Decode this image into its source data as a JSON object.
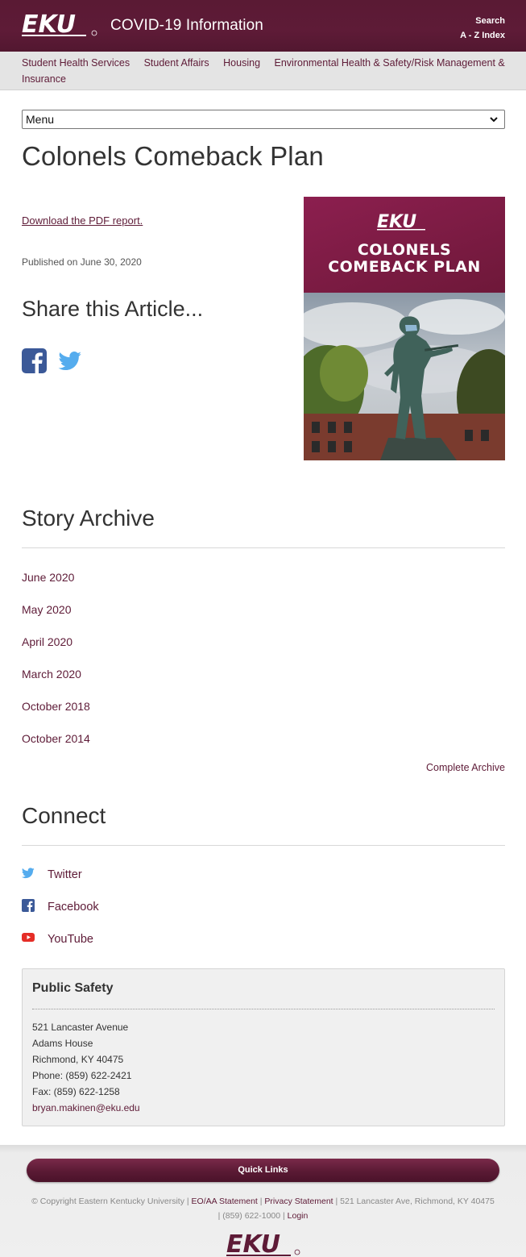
{
  "header": {
    "logo_text": "EKU",
    "site_title": "COVID-19 Information",
    "search_label": "Search",
    "az_label": "A - Z Index"
  },
  "subnav": {
    "items": [
      {
        "label": "Student Health Services"
      },
      {
        "label": "Student Affairs"
      },
      {
        "label": "Housing"
      },
      {
        "label": "Environmental Health & Safety/Risk Management & Insurance"
      }
    ]
  },
  "menu": {
    "selected": "Menu"
  },
  "article": {
    "title": "Colonels Comeback Plan",
    "pdf_link": "Download the PDF report.",
    "published": "Published on June 30, 2020",
    "share_title": "Share this Article..."
  },
  "cover": {
    "logo_text": "EKU",
    "title_line1": "COLONELS",
    "title_line2": "COMEBACK PLAN"
  },
  "archive": {
    "title": "Story Archive",
    "items": [
      {
        "label": "June 2020"
      },
      {
        "label": "May 2020"
      },
      {
        "label": "April 2020"
      },
      {
        "label": "March 2020"
      },
      {
        "label": "October 2018"
      },
      {
        "label": "October 2014"
      }
    ],
    "complete_label": "Complete Archive"
  },
  "connect": {
    "title": "Connect",
    "items": [
      {
        "label": "Twitter",
        "icon": "twitter-icon"
      },
      {
        "label": "Facebook",
        "icon": "facebook-icon"
      },
      {
        "label": "YouTube",
        "icon": "youtube-icon"
      }
    ]
  },
  "public_safety": {
    "title": "Public Safety",
    "address1": "521 Lancaster Avenue",
    "address2": "Adams House",
    "address3": "Richmond, KY 40475",
    "phone": "Phone: (859) 622-2421",
    "fax": "Fax: (859) 622-1258",
    "email": "bryan.makinen@eku.edu"
  },
  "footer": {
    "quick_links": "Quick Links",
    "copyright": "© Copyright Eastern Kentucky University",
    "eo_link": "EO/AA Statement",
    "privacy_link": "Privacy Statement",
    "address": "521 Lancaster Ave, Richmond, KY 40475",
    "phone": "(859) 622-1000",
    "login_link": "Login",
    "logo_text": "EKU"
  },
  "colors": {
    "brand_maroon": "#5e1b37",
    "cover_magenta": "#8c1f4f",
    "facebook_blue": "#3b5998",
    "twitter_blue": "#55acee",
    "youtube_red": "#e52d27"
  }
}
